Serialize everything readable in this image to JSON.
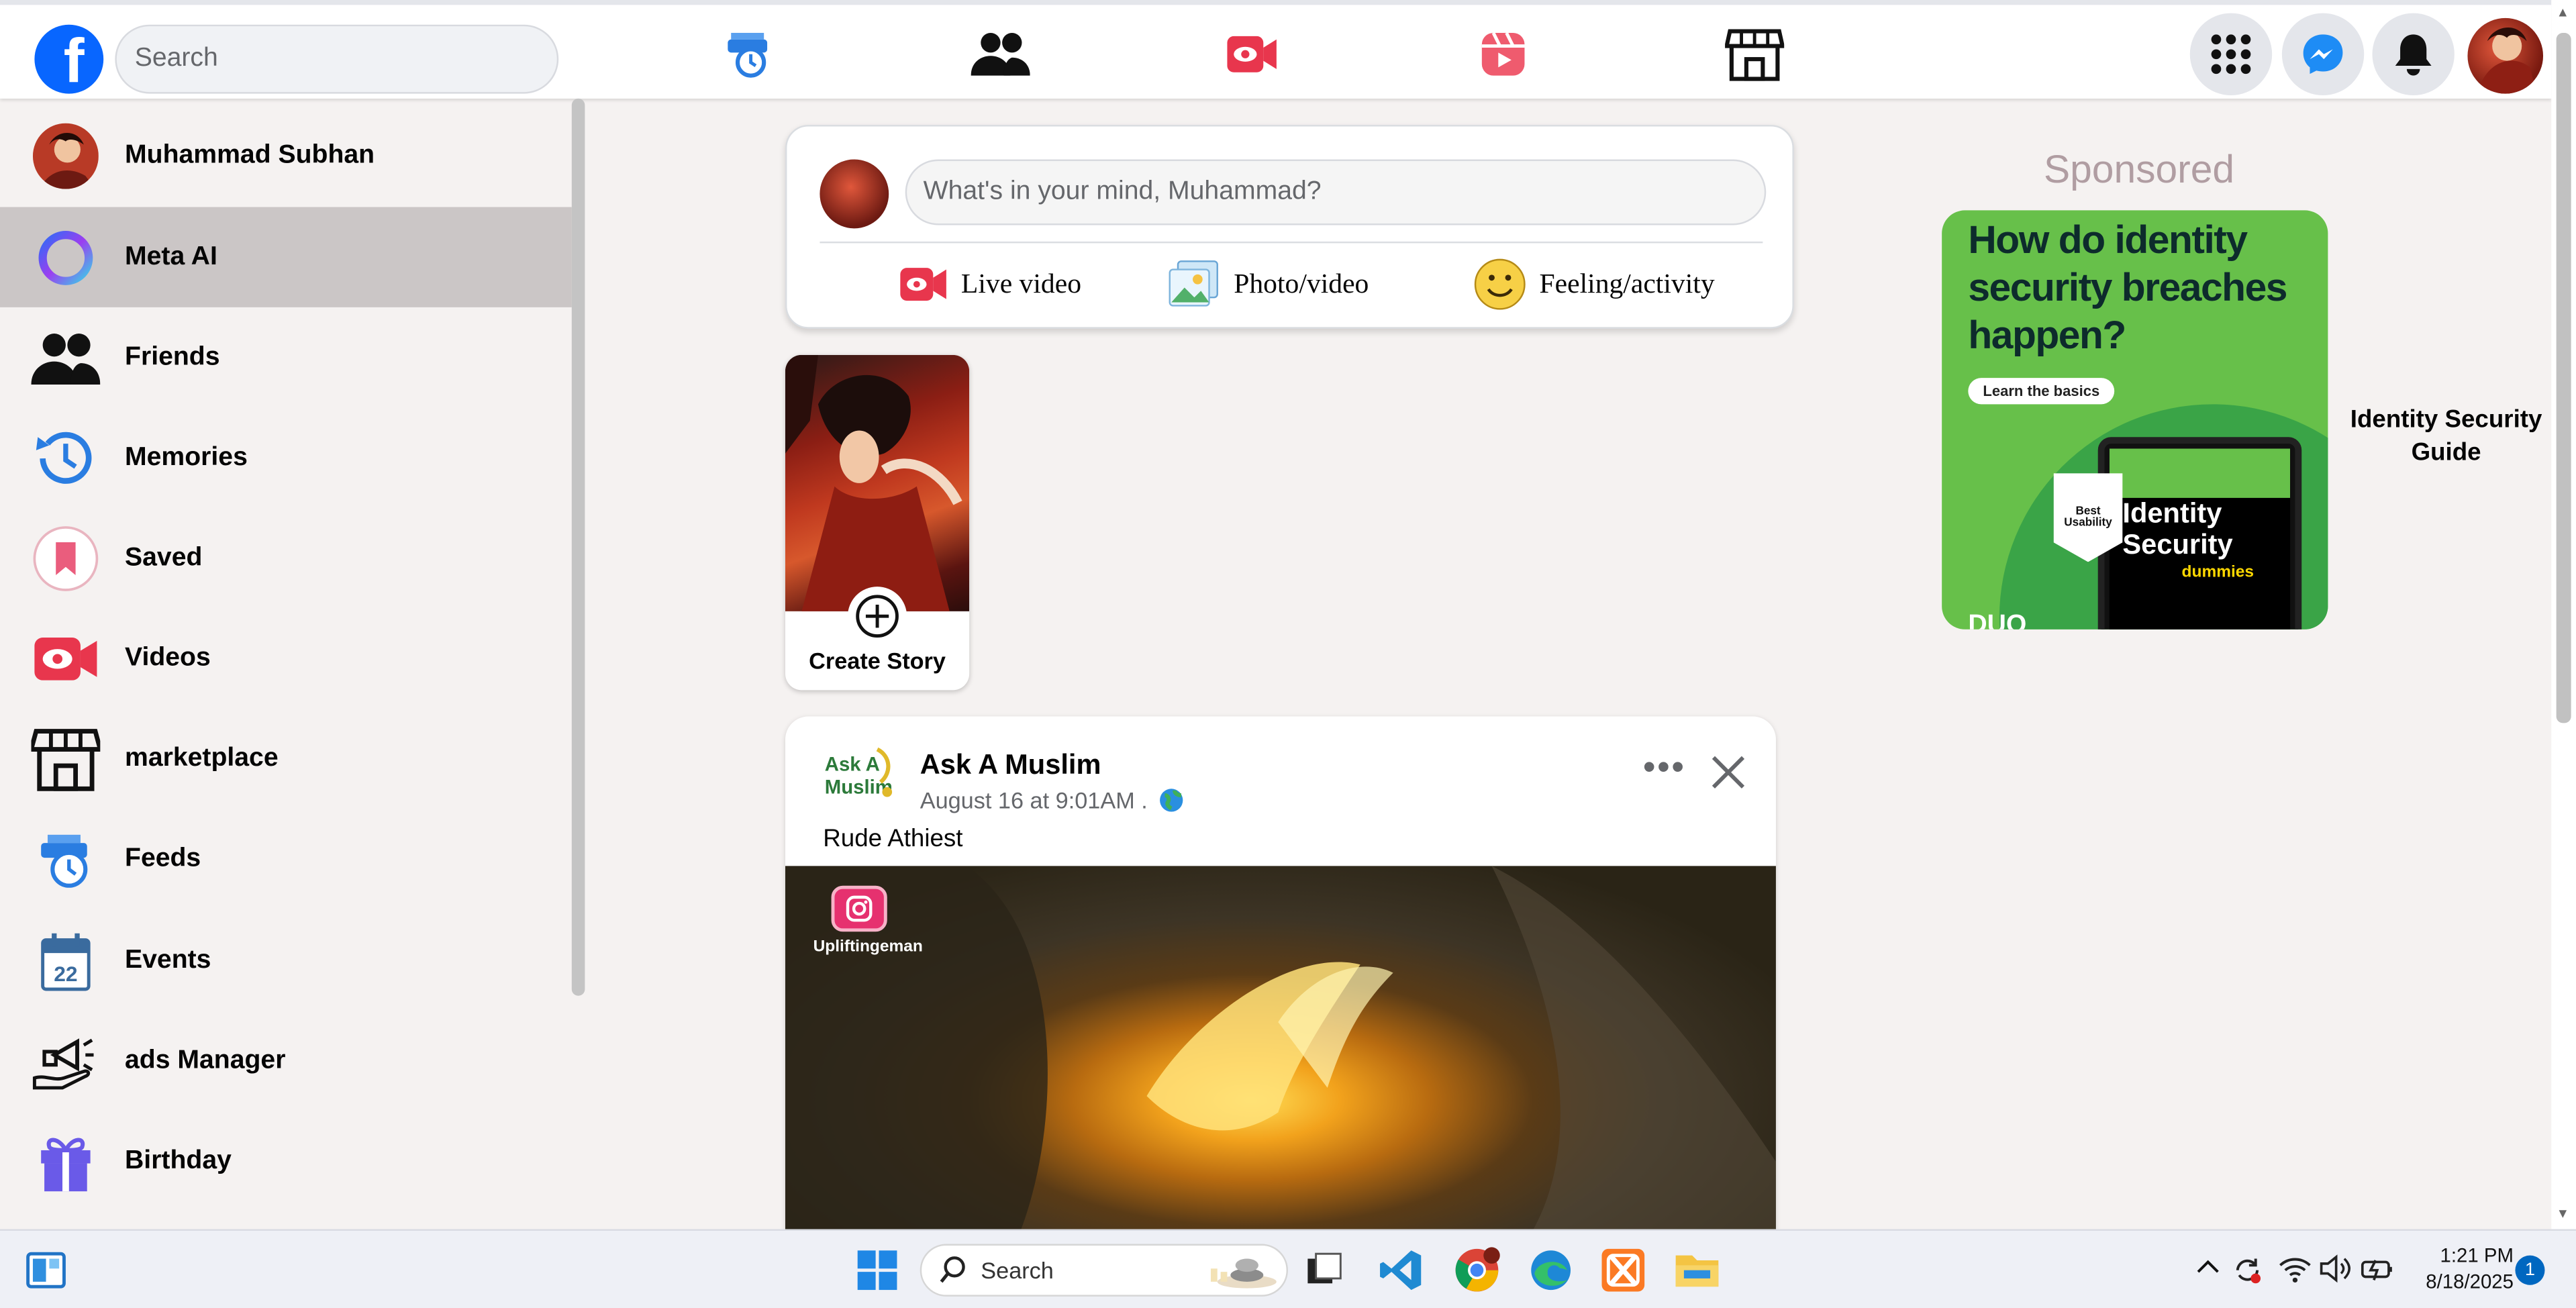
{
  "topbar": {
    "logo": "facebook-logo",
    "search_placeholder": "Search",
    "nav": [
      "feeds-icon",
      "friends-icon",
      "video-icon",
      "reels-icon",
      "marketplace-icon"
    ],
    "right": [
      "menu-grid-icon",
      "messenger-icon",
      "bell-icon",
      "profile-avatar"
    ]
  },
  "sidebar": {
    "items": [
      {
        "label": "Muhammad Subhan",
        "icon": "profile-avatar"
      },
      {
        "label": "Meta AI",
        "icon": "meta-ai-icon"
      },
      {
        "label": "Friends",
        "icon": "friends-icon"
      },
      {
        "label": "Memories",
        "icon": "memories-icon"
      },
      {
        "label": "Saved",
        "icon": "saved-icon"
      },
      {
        "label": "Videos",
        "icon": "video-icon"
      },
      {
        "label": "marketplace",
        "icon": "marketplace-icon"
      },
      {
        "label": "Feeds",
        "icon": "feeds-icon"
      },
      {
        "label": "Events",
        "icon": "calendar-icon"
      },
      {
        "label": "ads Manager",
        "icon": "megaphone-icon"
      },
      {
        "label": "Birthday",
        "icon": "gift-icon"
      }
    ],
    "events_day": "22"
  },
  "composer": {
    "placeholder": "What's in your mind, Muhammad?",
    "live_video": "Live video",
    "photo_video": "Photo/video",
    "feeling": "Feeling/activity"
  },
  "story": {
    "label": "Create Story"
  },
  "post": {
    "page_name": "Ask A Muslim",
    "logo_text_1": "Ask A",
    "logo_text_2": "Muslim",
    "timestamp": "August 16 at 9:01AM . ",
    "text": "Rude Athiest",
    "watermark": "Upliftingeman"
  },
  "sponsored": {
    "title": "Sponsored",
    "ad_headline": "How do identity security breaches happen?",
    "ad_button": "Learn the basics",
    "ad_tablet_title": "Identity Security",
    "ad_tablet_sub": "dummies",
    "ad_badge": "Best Usability",
    "ad_brand": "DUO",
    "caption": "Identity Security Guide"
  },
  "taskbar": {
    "search_label": "Search",
    "time": "1:21 PM",
    "date": "8/18/2025",
    "notification_count": "1"
  },
  "colors": {
    "brand_blue": "#0866ff",
    "page_bg": "#f5f2f1",
    "active_item": "#cbc6c6",
    "ad_green": "#67c04a"
  }
}
